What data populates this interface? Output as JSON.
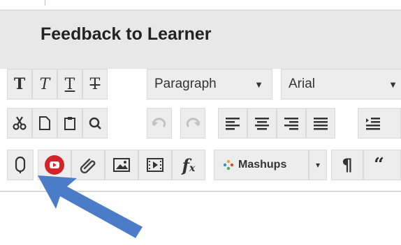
{
  "header": {
    "title": "Feedback to Learner"
  },
  "toolbar": {
    "row1": {
      "format_select": "Paragraph",
      "font_select": "Arial"
    },
    "row3": {
      "mashups_label": "Mashups"
    }
  },
  "icons": {
    "bold": "bold-T-icon",
    "italic": "italic-T-icon",
    "underline": "underline-T-icon",
    "strikethrough": "strikethrough-T-icon",
    "cut": "scissors-icon",
    "copy": "page-icon",
    "paste": "clipboard-icon",
    "find": "search-icon",
    "undo": "undo-icon",
    "redo": "redo-icon",
    "align_left": "align-left-icon",
    "align_center": "align-center-icon",
    "align_right": "align-right-icon",
    "justify": "justify-icon",
    "list": "list-icon",
    "record_audio": "microphone-icon",
    "youtube": "youtube-icon",
    "attach": "paperclip-icon",
    "image": "image-icon",
    "video": "video-icon",
    "math": "fx-icon",
    "pilcrow": "pilcrow-icon",
    "quote": "quote-icon",
    "annotation_arrow": "blue-arrow-icon"
  },
  "colors": {
    "header_bg": "#e8e8e8",
    "button_bg": "#ededed",
    "youtube_red": "#d52128",
    "arrow_blue": "#4a7cc7"
  }
}
